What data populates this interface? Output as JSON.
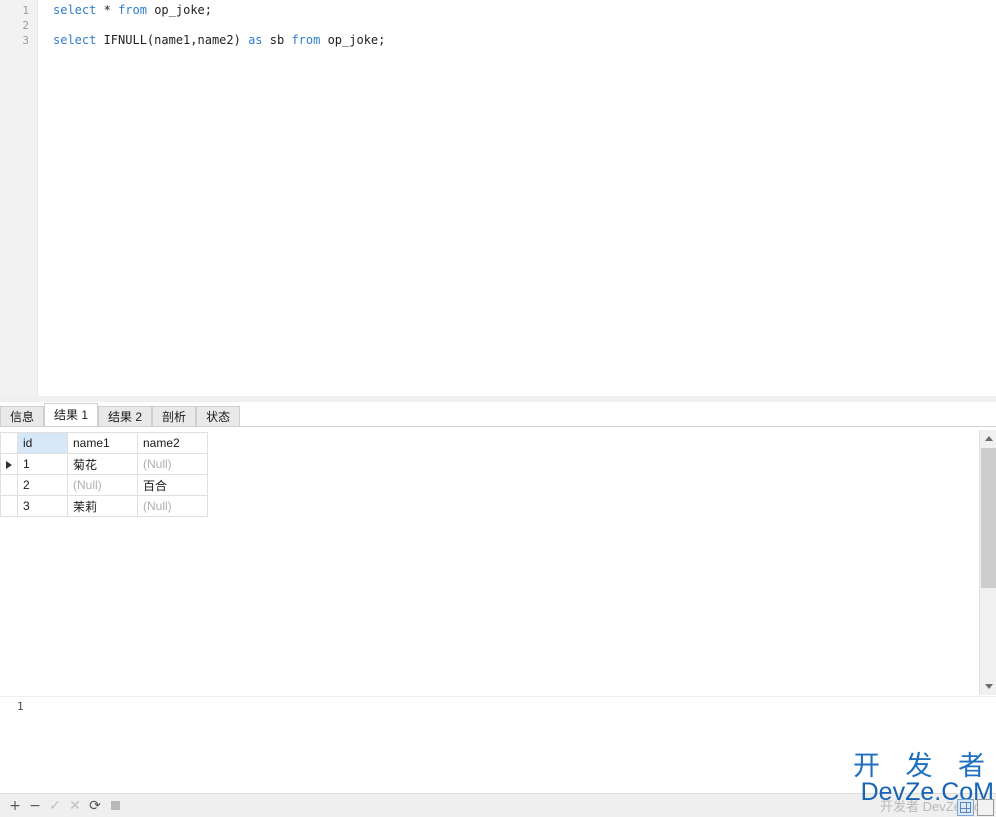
{
  "editor": {
    "line_numbers": [
      "1",
      "2",
      "3"
    ],
    "lines": [
      [
        {
          "t": "select",
          "c": "kw"
        },
        {
          "t": " ",
          "c": "plain"
        },
        {
          "t": "*",
          "c": "plain"
        },
        {
          "t": " ",
          "c": "plain"
        },
        {
          "t": "from",
          "c": "kw"
        },
        {
          "t": " op_joke;",
          "c": "plain"
        }
      ],
      [],
      [
        {
          "t": "select",
          "c": "kw"
        },
        {
          "t": " IFNULL(name1,name2) ",
          "c": "plain"
        },
        {
          "t": "as",
          "c": "kw"
        },
        {
          "t": " sb ",
          "c": "plain"
        },
        {
          "t": "from",
          "c": "kw"
        },
        {
          "t": " op_joke;",
          "c": "plain"
        }
      ]
    ],
    "plain_text": [
      "select * from op_joke;",
      "",
      "select IFNULL(name1,name2) as sb from op_joke;"
    ]
  },
  "tabs": [
    {
      "label": "信息",
      "active": false
    },
    {
      "label": "结果 1",
      "active": true
    },
    {
      "label": "结果 2",
      "active": false
    },
    {
      "label": "剖析",
      "active": false
    },
    {
      "label": "状态",
      "active": false
    }
  ],
  "grid": {
    "columns": [
      {
        "key": "id",
        "label": "id",
        "selected": true
      },
      {
        "key": "name1",
        "label": "name1",
        "selected": false
      },
      {
        "key": "name2",
        "label": "name2",
        "selected": false
      }
    ],
    "null_text": "(Null)",
    "current_row_index": 0,
    "rows": [
      {
        "id": "1",
        "name1": "菊花",
        "name1_null": false,
        "name2": "(Null)",
        "name2_null": true
      },
      {
        "id": "2",
        "name1": "(Null)",
        "name1_null": true,
        "name2": "百合",
        "name2_null": false
      },
      {
        "id": "3",
        "name1": "茉莉",
        "name1_null": false,
        "name2": "(Null)",
        "name2_null": true
      }
    ]
  },
  "status": {
    "row_count_text": "1"
  },
  "bottom_toolbar": {
    "buttons": [
      {
        "name": "add-record-button",
        "glyph": "+",
        "enabled": true
      },
      {
        "name": "delete-record-button",
        "glyph": "−",
        "enabled": true
      },
      {
        "name": "apply-changes-button",
        "glyph": "✓",
        "enabled": false
      },
      {
        "name": "cancel-changes-button",
        "glyph": "✕",
        "enabled": false
      },
      {
        "name": "refresh-button",
        "glyph": "⟳",
        "enabled": true
      },
      {
        "name": "stop-button",
        "glyph": "■",
        "enabled": false
      }
    ]
  },
  "watermark": {
    "line_cn": "开 发 者",
    "line_en": "DevZe.CoM",
    "ghost": "开发者 DevZe.CoM"
  },
  "colors": {
    "keyword": "#2f7fd0",
    "identifier": "#222222",
    "null_value": "#b0b0b0",
    "selected_header": "#d6e8f7",
    "watermark_blue": "#1d6fc0",
    "toolbar_bg": "#efefef",
    "gutter_bg": "#f2f2f2"
  }
}
